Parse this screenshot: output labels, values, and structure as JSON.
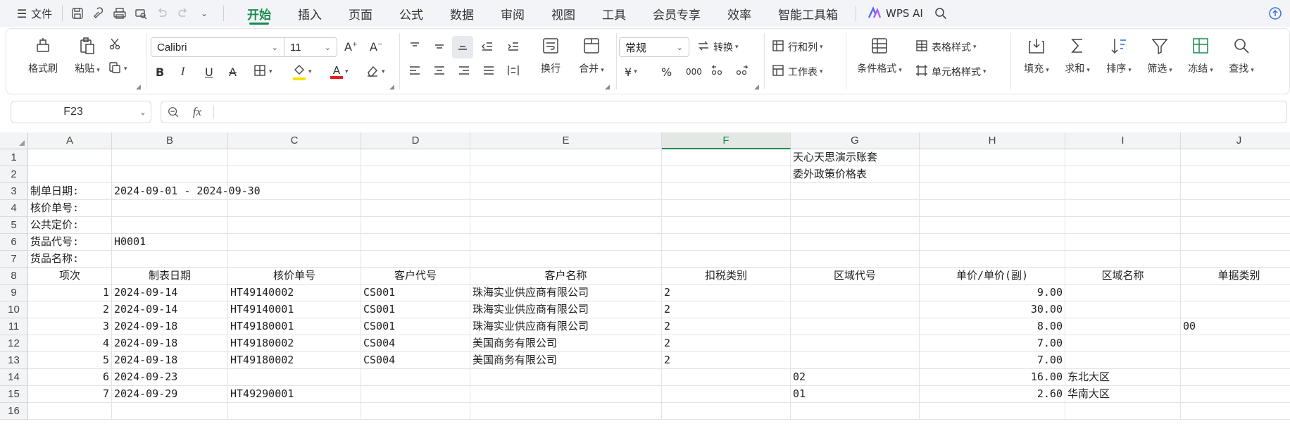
{
  "menubar": {
    "file_label": "文件",
    "tabs": [
      {
        "label": "开始",
        "active": true
      },
      {
        "label": "插入",
        "active": false
      },
      {
        "label": "页面",
        "active": false
      },
      {
        "label": "公式",
        "active": false
      },
      {
        "label": "数据",
        "active": false
      },
      {
        "label": "审阅",
        "active": false
      },
      {
        "label": "视图",
        "active": false
      },
      {
        "label": "工具",
        "active": false
      },
      {
        "label": "会员专享",
        "active": false
      },
      {
        "label": "效率",
        "active": false
      },
      {
        "label": "智能工具箱",
        "active": false
      }
    ],
    "wps_ai_label": "WPS AI"
  },
  "ribbon": {
    "format_painter": "格式刷",
    "paste": "粘贴",
    "font_name": "Calibri",
    "font_size": "11",
    "wrap_text": "换行",
    "merge": "合并",
    "number_format": "常规",
    "convert": "转换",
    "rows_cols": "行和列",
    "worksheet": "工作表",
    "conditional_format": "条件格式",
    "table_style": "表格样式",
    "cell_style": "单元格样式",
    "fill": "填充",
    "sum": "求和",
    "sort": "排序",
    "filter": "筛选",
    "freeze": "冻结",
    "find": "查找",
    "currency_symbol": "¥",
    "percent_symbol": "%",
    "thousands_symbol": "000",
    "accent_color": "#1a8a4f",
    "font_color": "#e02020",
    "highlight_color": "#f5e100"
  },
  "formula_bar": {
    "cell_ref": "F23",
    "fx_label": "fx",
    "content": ""
  },
  "grid": {
    "selected_column": "F",
    "selected_cell": "F23",
    "columns": [
      "A",
      "B",
      "C",
      "D",
      "E",
      "F",
      "G",
      "H",
      "I",
      "J"
    ],
    "rows": [
      "1",
      "2",
      "3",
      "4",
      "5",
      "6",
      "7",
      "8",
      "9",
      "10",
      "11",
      "12",
      "13",
      "14",
      "15",
      "16"
    ],
    "cells": {
      "G1": "天心天思演示账套",
      "G2": "委外政策价格表",
      "A3": "制单日期:",
      "B3": "2024-09-01 - 2024-09-30",
      "A4": "核价单号:",
      "A5": "公共定价:",
      "A6": "货品代号:",
      "B6": "H0001",
      "A7": "货品名称:",
      "A8": "项次",
      "B8": "制表日期",
      "C8": "核价单号",
      "D8": "客户代号",
      "E8": "客户名称",
      "F8": "扣税类别",
      "G8": "区域代号",
      "H8": "单价/单价(副)",
      "I8": "区域名称",
      "J8": "单据类别",
      "A9": "1",
      "B9": "2024-09-14",
      "C9": "HT49140002",
      "D9": "CS001",
      "E9": "珠海实业供应商有限公司",
      "F9": "2",
      "H9": "9.00",
      "A10": "2",
      "B10": "2024-09-14",
      "C10": "HT49140001",
      "D10": "CS001",
      "E10": "珠海实业供应商有限公司",
      "F10": "2",
      "H10": "30.00",
      "A11": "3",
      "B11": "2024-09-18",
      "C11": "HT49180001",
      "D11": "CS001",
      "E11": "珠海实业供应商有限公司",
      "F11": "2",
      "H11": "8.00",
      "J11": "00",
      "A12": "4",
      "B12": "2024-09-18",
      "C12": "HT49180002",
      "D12": "CS004",
      "E12": "美国商务有限公司",
      "F12": "2",
      "H12": "7.00",
      "A13": "5",
      "B13": "2024-09-18",
      "C13": "HT49180002",
      "D13": "CS004",
      "E13": "美国商务有限公司",
      "F13": "2",
      "H13": "7.00",
      "A14": "6",
      "B14": "2024-09-23",
      "G14": "02",
      "H14": "16.00",
      "I14": "东北大区",
      "A15": "7",
      "B15": "2024-09-29",
      "C15": "HT49290001",
      "G15": "01",
      "H15": "2.60",
      "I15": "华南大区"
    }
  }
}
